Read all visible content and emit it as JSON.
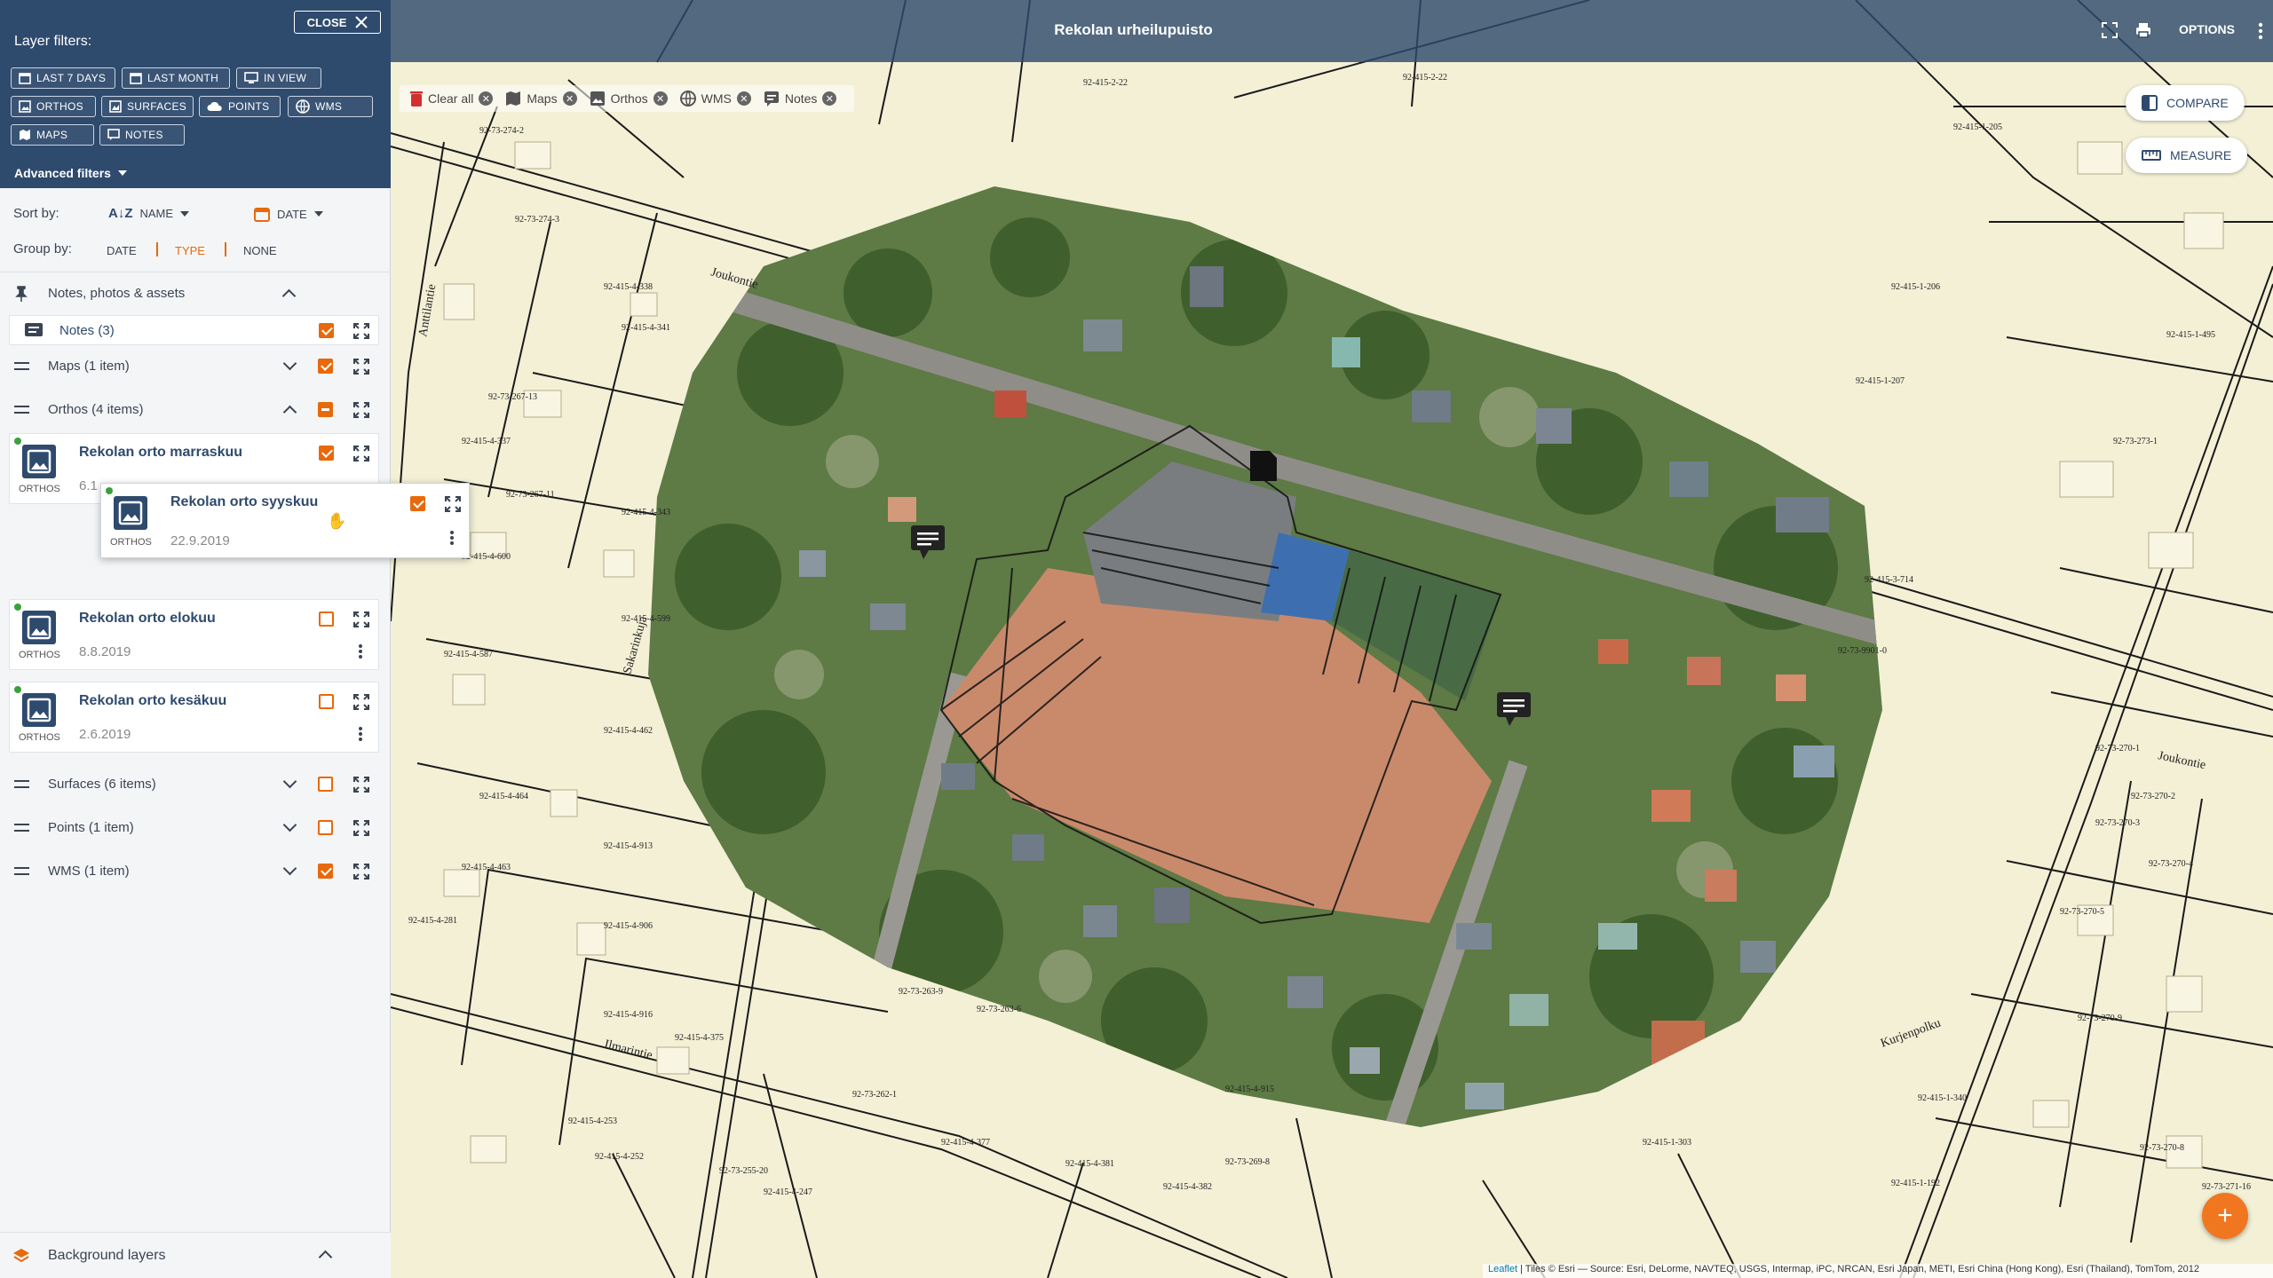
{
  "header": {
    "title": "Rekolan urheilupuisto",
    "options_label": "OPTIONS"
  },
  "filters": {
    "title": "Layer filters:",
    "close_label": "CLOSE",
    "chips": {
      "last7": "LAST 7 DAYS",
      "lastmonth": "LAST MONTH",
      "inview": "IN VIEW",
      "orthos": "ORTHOS",
      "surfaces": "SURFACES",
      "points": "POINTS",
      "wms": "WMS",
      "maps": "MAPS",
      "notes": "NOTES"
    },
    "advanced_label": "Advanced filters"
  },
  "sort": {
    "label": "Sort by:",
    "name_label": "NAME",
    "date_label": "DATE"
  },
  "group": {
    "label": "Group by:",
    "options": [
      "DATE",
      "TYPE",
      "NONE"
    ],
    "selected": "TYPE"
  },
  "layers": {
    "notes_section": "Notes, photos & assets",
    "notes": "Notes (3)",
    "maps": "Maps (1 item)",
    "orthos": "Orthos (4 items)",
    "surfaces": "Surfaces (6 items)",
    "points": "Points (1 item)",
    "wms": "WMS (1 item)"
  },
  "orthos_items": [
    {
      "name": "Rekolan orto marraskuu",
      "date": "6.1",
      "tag": "ORTHOS"
    },
    {
      "name": "Rekolan orto syyskuu",
      "date": "22.9.2019",
      "tag": "ORTHOS"
    },
    {
      "name": "Rekolan orto elokuu",
      "date": "8.8.2019",
      "tag": "ORTHOS"
    },
    {
      "name": "Rekolan orto kesäkuu",
      "date": "2.6.2019",
      "tag": "ORTHOS"
    }
  ],
  "background_layers": "Background layers",
  "filterbar": {
    "clear": "Clear all",
    "maps": "Maps",
    "orthos": "Orthos",
    "wms": "WMS",
    "notes": "Notes"
  },
  "tools": {
    "compare": "COMPARE",
    "measure": "MEASURE"
  },
  "map": {
    "streets": [
      "Joukontie",
      "Joukontie",
      "Sakarinkuja",
      "Ilmarintie",
      "Anttilantie",
      "Kurjenpolku"
    ],
    "parcels": [
      "92-415-2-22",
      "92-73-274-2",
      "92-73-274-3",
      "92-415-4-338",
      "92-415-4-341",
      "92-73-267-13",
      "92-415-4-337",
      "92-73-267-11",
      "92-415-4-343",
      "92-415-4-600",
      "92-415-4-599",
      "92-415-4-587",
      "92-415-4-462",
      "92-415-4-464",
      "92-415-4-913",
      "92-415-4-463",
      "92-415-4-906",
      "92-415-4-281",
      "92-415-4-916",
      "92-415-4-375",
      "92-415-4-253",
      "92-415-4-252",
      "92-415-4-247",
      "92-415-4-377",
      "92-415-4-381",
      "92-415-4-382",
      "92-73-262-1",
      "92-73-255-20",
      "92-73-269-8",
      "92-415-1-205",
      "92-415-1-206",
      "92-415-1-207",
      "92-73-273-1",
      "92-415-3-714",
      "92-73-270-1",
      "92-73-270-2",
      "92-73-270-3",
      "92-73-270-4",
      "92-73-270-5",
      "92-73-270-9",
      "92-73-270-8",
      "92-415-1-340",
      "92-415-1-303",
      "92-415-1-192",
      "92-415-2-22",
      "92-73-263-9",
      "92-73-263-6",
      "92-415-4-915",
      "92-73-9901-0",
      "92-415-1-495",
      "92-73-271-16"
    ]
  },
  "attribution": {
    "leaflet": "Leaflet",
    "text": " | Tiles © Esri — Source: Esri, DeLorme, NAVTEQ, USGS, Intermap, iPC, NRCAN, Esri Japan, METI, Esri China (Hong Kong), Esri (Thailand), TomTom, 2012"
  },
  "colors": {
    "header_navy": "#2e4a6d",
    "accent_orange": "#e8690b",
    "map_base": "#f3f0d6"
  }
}
